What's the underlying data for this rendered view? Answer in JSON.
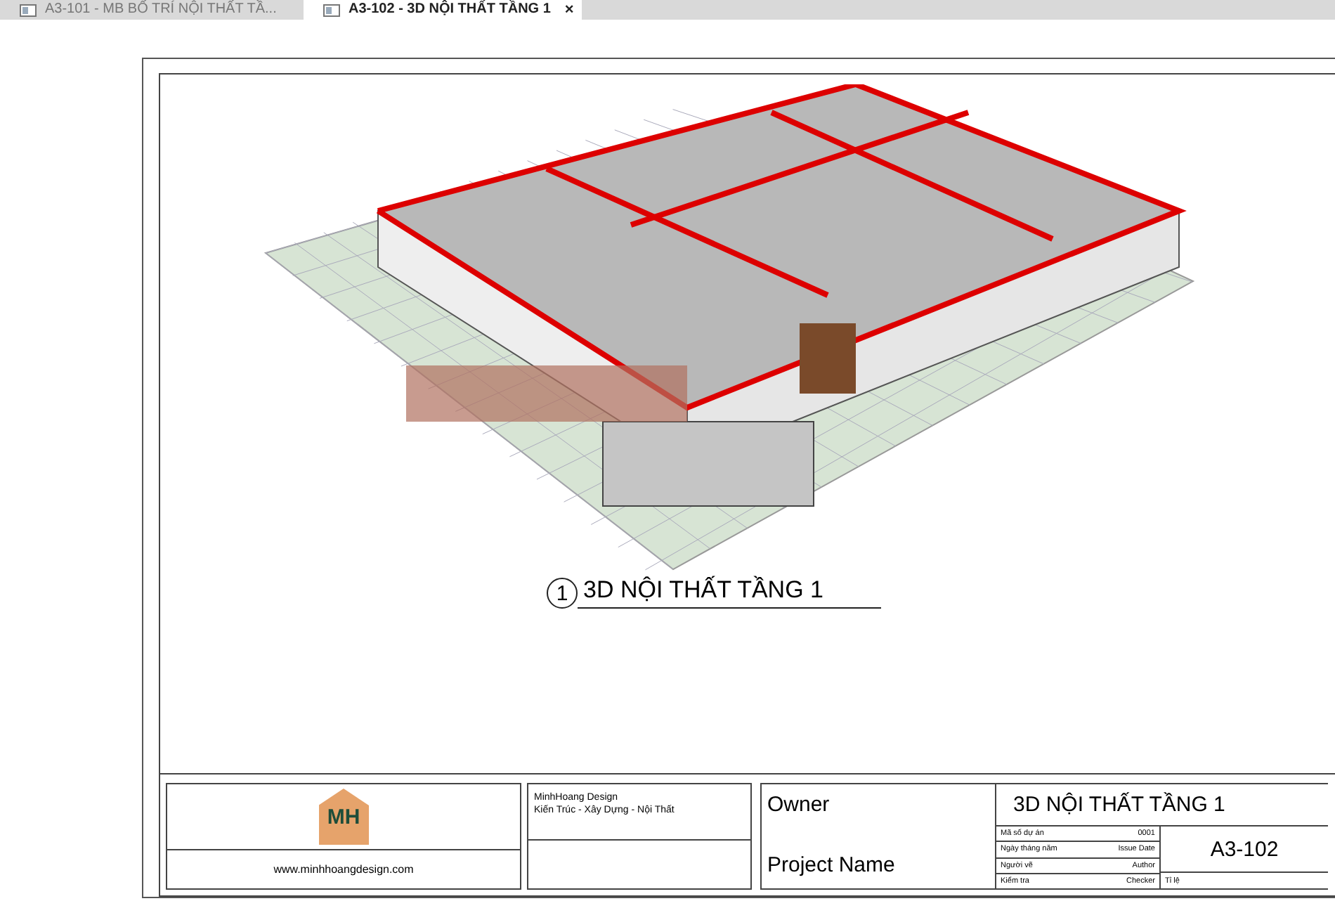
{
  "tabs": [
    {
      "label": "A3-101 - MB BỐ TRÍ NỘI THẤT TẦ...",
      "selected": false
    },
    {
      "label": "A3-102 - 3D NỘI THẤT TẦNG 1",
      "selected": true,
      "close": "×"
    }
  ],
  "view": {
    "number": "1",
    "title": "3D NỘI THẤT TẦNG 1"
  },
  "title_block": {
    "logo": "MH",
    "website": "www.minhhoangdesign.com",
    "company": "MinhHoang Design",
    "company_tagline": "Kiến Trúc - Xây Dựng - Nội Thất",
    "owner": "Owner",
    "project_name": "Project Name",
    "sheet_title": "3D NỘI THẤT TẦNG 1",
    "sheet_number": "A3-102",
    "fields": [
      {
        "label": "Mã số dự án",
        "value": "0001"
      },
      {
        "label": "Ngày tháng năm",
        "value": "Issue Date"
      },
      {
        "label": "Người vẽ",
        "value": "Author"
      },
      {
        "label": "Kiểm tra",
        "value": "Checker"
      }
    ],
    "scale_label": "Tỉ lệ"
  }
}
